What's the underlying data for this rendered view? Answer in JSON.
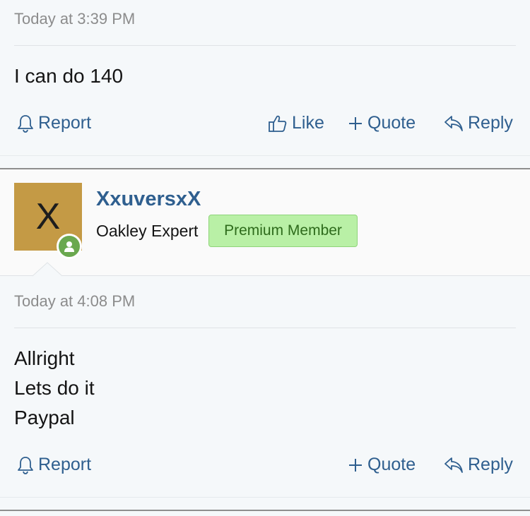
{
  "post1": {
    "timestamp": "Today at 3:39 PM",
    "message_lines": [
      "I can do 140"
    ],
    "actions": {
      "report": "Report",
      "like": "Like",
      "quote": "Quote",
      "reply": "Reply"
    }
  },
  "post2": {
    "user": {
      "avatar_letter": "X",
      "avatar_color": "#c49a45",
      "online_indicator": "user-icon",
      "username": "XxuversxX",
      "title": "Oakley Expert",
      "badge": "Premium Member"
    },
    "timestamp": "Today at 4:08 PM",
    "message_lines": [
      "Allright",
      "Lets do it",
      "Paypal"
    ],
    "actions": {
      "report": "Report",
      "quote": "Quote",
      "reply": "Reply"
    }
  },
  "colors": {
    "link": "#2f5f8f",
    "background": "#f5f8fa",
    "badge_bg": "#b9f0a6",
    "online": "#6aa84f"
  }
}
